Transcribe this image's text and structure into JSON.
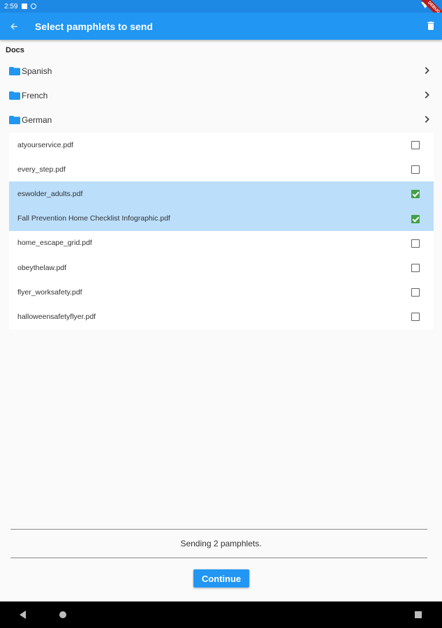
{
  "status_bar": {
    "time": "2:59",
    "debug_label": "DEBUG"
  },
  "app_bar": {
    "title": "Select pamphlets to send"
  },
  "section": {
    "title": "Docs"
  },
  "folders": [
    {
      "label": "Spanish"
    },
    {
      "label": "French"
    },
    {
      "label": "German"
    }
  ],
  "files": [
    {
      "name": "atyourservice.pdf",
      "checked": false
    },
    {
      "name": "every_step.pdf",
      "checked": false
    },
    {
      "name": "eswolder_adults.pdf",
      "checked": true
    },
    {
      "name": "Fall Prevention Home Checklist Infographic.pdf",
      "checked": true
    },
    {
      "name": "home_escape_grid.pdf",
      "checked": false
    },
    {
      "name": "obeythelaw.pdf",
      "checked": false
    },
    {
      "name": "flyer_worksafety.pdf",
      "checked": false
    },
    {
      "name": "halloweensafetyflyer.pdf",
      "checked": false
    }
  ],
  "footer": {
    "sending_text": "Sending 2 pamphlets.",
    "continue_label": "Continue"
  },
  "colors": {
    "app_bar": "#2196f3",
    "status_bar": "#1e88e5",
    "selected_row": "#bbdefb",
    "checkbox_checked": "#43a047",
    "folder_icon": "#2196f3"
  }
}
